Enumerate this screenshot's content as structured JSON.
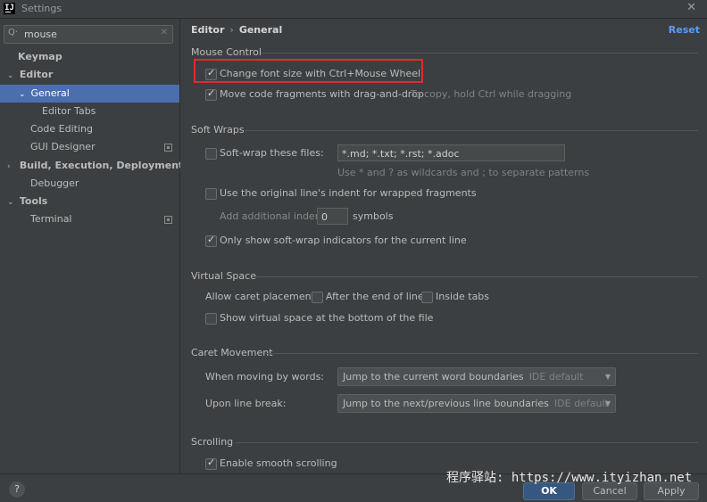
{
  "window": {
    "title": "Settings",
    "app_icon_text": "IJ"
  },
  "sidebar": {
    "search_value": "mouse",
    "items": [
      {
        "label": "Keymap"
      },
      {
        "label": "Editor"
      },
      {
        "label": "General"
      },
      {
        "label": "Editor Tabs"
      },
      {
        "label": "Code Editing"
      },
      {
        "label": "GUI Designer"
      },
      {
        "label": "Build, Execution, Deployment"
      },
      {
        "label": "Debugger"
      },
      {
        "label": "Tools"
      },
      {
        "label": "Terminal"
      }
    ]
  },
  "header": {
    "crumb1": "Editor",
    "crumb_sep": "›",
    "crumb2": "General",
    "reset": "Reset"
  },
  "mouse_control": {
    "title": "Mouse Control",
    "change_font": "Change font size with Ctrl+Mouse Wheel",
    "move_fragments": "Move code fragments with drag-and-drop",
    "move_hint": "To copy, hold Ctrl while dragging"
  },
  "soft_wraps": {
    "title": "Soft Wraps",
    "soft_wrap_files": "Soft-wrap these files:",
    "files_value": "*.md; *.txt; *.rst; *.adoc",
    "files_hint": "Use * and ? as wildcards and ; to separate patterns",
    "original_indent": "Use the original line's indent for wrapped fragments",
    "additional_indent": "Add additional indent:",
    "indent_value": "0",
    "symbols": "symbols",
    "only_show": "Only show soft-wrap indicators for the current line"
  },
  "virtual_space": {
    "title": "Virtual Space",
    "allow_caret": "Allow caret placement:",
    "after_end": "After the end of line",
    "inside_tabs": "Inside tabs",
    "show_virtual": "Show virtual space at the bottom of the file"
  },
  "caret_movement": {
    "title": "Caret Movement",
    "moving_words": "When moving by words:",
    "words_value": "Jump to the current word boundaries",
    "words_default": "IDE default",
    "line_break": "Upon line break:",
    "break_value": "Jump to the next/previous line boundaries",
    "break_default": "IDE default"
  },
  "scrolling": {
    "title": "Scrolling",
    "smooth": "Enable smooth scrolling"
  },
  "footer": {
    "help": "?",
    "ok": "OK",
    "cancel": "Cancel",
    "apply": "Apply"
  },
  "watermark": "程序驿站: https://www.ityizhan.net",
  "colors": {
    "selection": "#4b6eaf",
    "link": "#589df6",
    "highlight_box": "#e02b2b",
    "primary_button": "#365880"
  }
}
